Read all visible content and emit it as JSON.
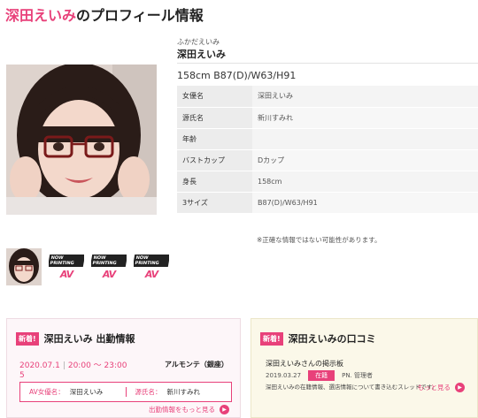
{
  "page": {
    "title_pink": "深田えいみ",
    "title_dark": "のプロフィール情報"
  },
  "profile": {
    "furigana": "ふかだえいみ",
    "name": "深田えいみ",
    "measurements": "158cm B87(D)/W63/H91",
    "rows": [
      {
        "label": "女優名",
        "value": "深田えいみ"
      },
      {
        "label": "源氏名",
        "value": "新川すみれ"
      },
      {
        "label": "年齢",
        "value": ""
      },
      {
        "label": "バストカップ",
        "value": "Dカップ"
      },
      {
        "label": "身長",
        "value": "158cm"
      },
      {
        "label": "3サイズ",
        "value": "B87(D)/W63/H91"
      }
    ],
    "note": "※正確な情報ではない可能性があります。"
  },
  "thumbs": {
    "badge_top": "NOW PRINTING",
    "badge_logo": "AV"
  },
  "schedule": {
    "badge": "新着!",
    "title": "深田えいみ 出勤情報",
    "date": "2020.07.1",
    "time": "20:00 〜 23:00",
    "day": "5",
    "venue": "アルモンテ（銀座）",
    "actress_label": "AV女優名：",
    "actress_value": "深田えいみ",
    "stage_label": "源氏名：",
    "stage_value": "新川すみれ",
    "more": "出勤情報をもっと見る"
  },
  "reviews": {
    "badge": "新着!",
    "title": "深田えいみの口コミ",
    "board_title": "深田えいみさんの掲示板",
    "board_date": "2019.03.27",
    "board_tag": "在籍",
    "board_author": "PN. 管理者",
    "board_desc": "深田えいみの在籍情報、選店情報について書き込むスレッドです。",
    "more": "もっと見る"
  },
  "colors": {
    "accent": "#e8417a"
  }
}
